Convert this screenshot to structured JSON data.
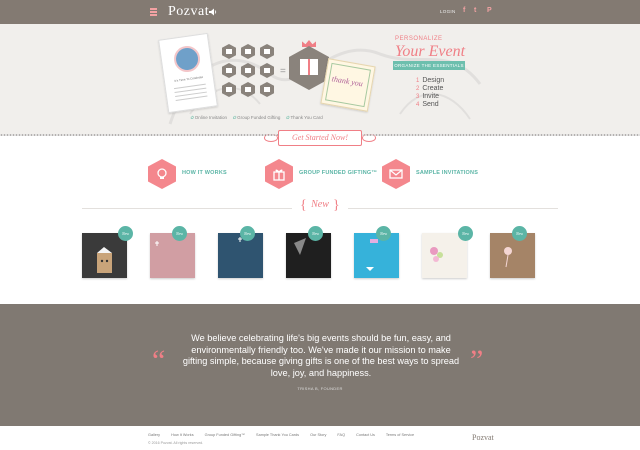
{
  "header": {
    "logo": "Pozvat",
    "login": "LOGIN",
    "social": [
      {
        "icon": "facebook-icon",
        "glyph": "f"
      },
      {
        "icon": "twitter-icon",
        "glyph": "t"
      },
      {
        "icon": "pinterest-icon",
        "glyph": "P"
      }
    ]
  },
  "hero": {
    "invite_title": "It's Time To Celebrate",
    "thanks_text": "thank you",
    "features": [
      "Online Invitation",
      "Group Funded Gifting",
      "Thank You Card"
    ],
    "personalize": "PERSONALIZE",
    "your_event": "Your Event",
    "ribbon": "ORGANIZE THE ESSENTIALS",
    "steps": [
      {
        "num": "1",
        "label": "Design"
      },
      {
        "num": "2",
        "label": "Create"
      },
      {
        "num": "3",
        "label": "Invite"
      },
      {
        "num": "4",
        "label": "Send"
      }
    ],
    "cta": "Get Started Now!"
  },
  "features": [
    {
      "label": "HOW IT WORKS",
      "icon": "lightbulb-icon"
    },
    {
      "label": "GROUP FUNDED GIFTING™",
      "icon": "gift-icon"
    },
    {
      "label": "SAMPLE INVITATIONS",
      "icon": "envelope-icon"
    }
  ],
  "new_section": {
    "label": "New",
    "badge": "New"
  },
  "products": [
    {
      "color": "#3a3a3a"
    },
    {
      "color": "#d19ea3"
    },
    {
      "color": "#2f5470"
    },
    {
      "color": "#1f1f1f"
    },
    {
      "color": "#36b2da"
    },
    {
      "color": "#f5f1ea"
    },
    {
      "color": "#a58467"
    }
  ],
  "quote": {
    "text": "We believe celebrating life's big events should be fun, easy, and environmentally friendly too. We've made it our mission to make gifting simple, because giving gifts is one of the best ways to spread love, joy, and happiness.",
    "author": "TRISHA B, FOUNDER",
    "open_mark": "“",
    "close_mark": "”"
  },
  "footer": {
    "links": [
      "Gallery",
      "How It Works",
      "Group Funded Gifting™",
      "Sample Thank You Cards",
      "Our Story",
      "FAQ",
      "Contact Us",
      "Terms of Service"
    ],
    "copyright": "© 2016 Pozvat. All rights reserved.",
    "logo": "Pozvat"
  },
  "colors": {
    "accent_pink": "#f07f86",
    "accent_teal": "#5bb5a6",
    "band_gray": "#807972"
  }
}
